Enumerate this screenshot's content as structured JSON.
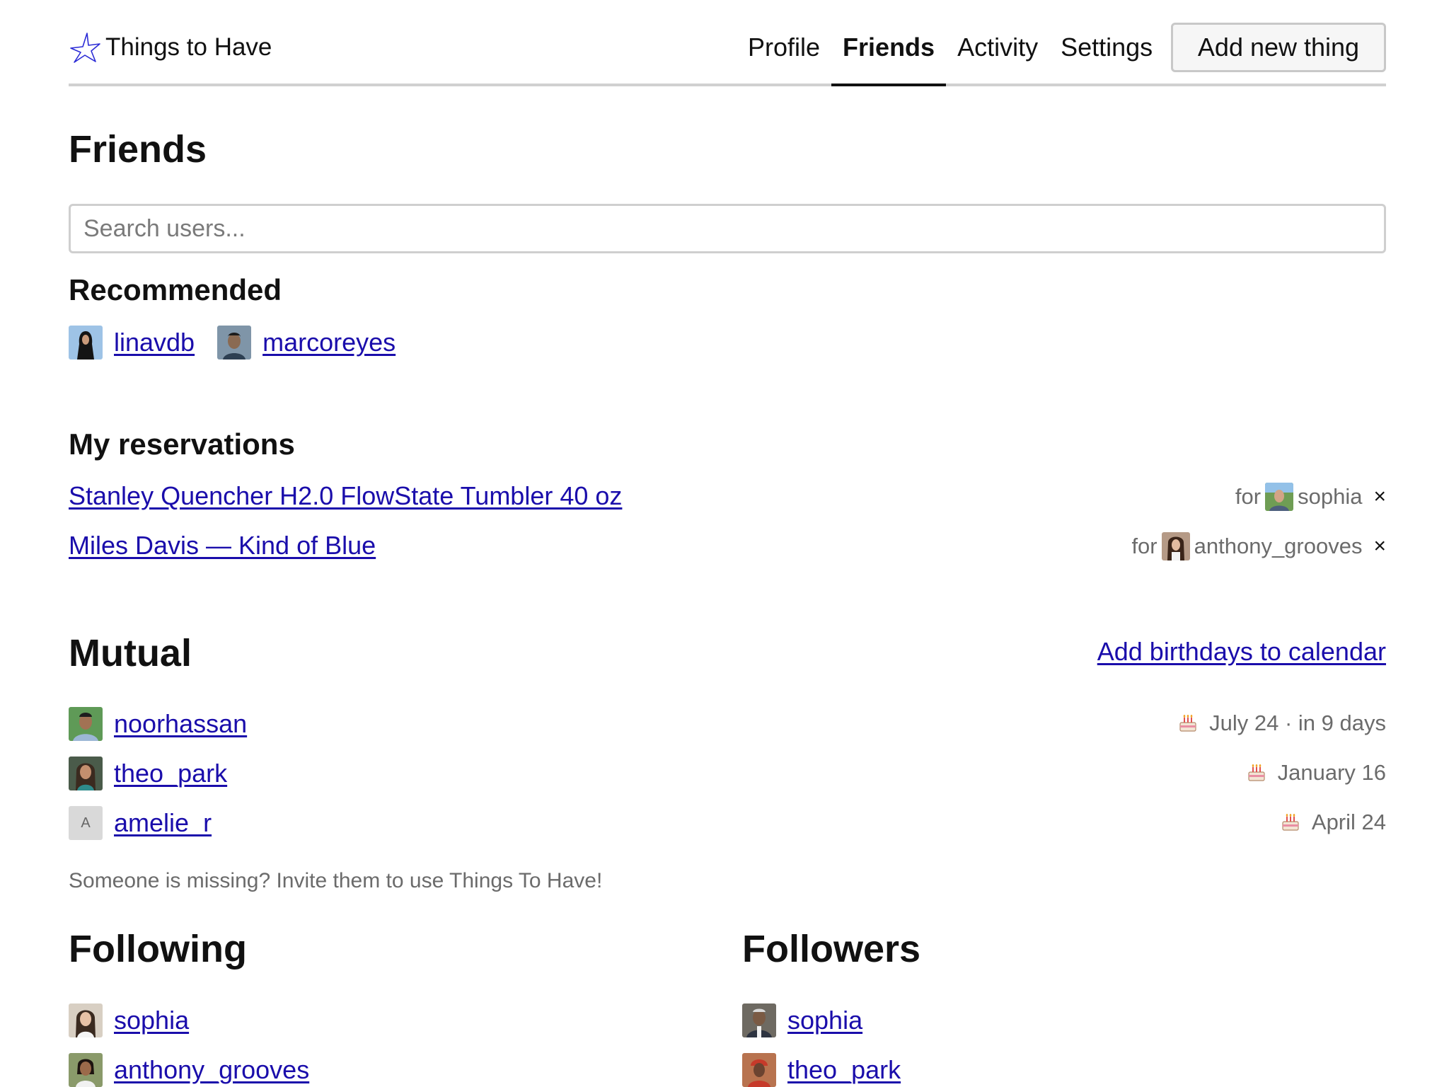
{
  "app": {
    "name": "Things to Have",
    "nav": [
      "Profile",
      "Friends",
      "Activity",
      "Settings"
    ],
    "active_nav": "Friends",
    "add_button": "Add new thing"
  },
  "page": {
    "title": "Friends",
    "search_placeholder": "Search users..."
  },
  "recommended": {
    "heading": "Recommended",
    "users": [
      "linavdb",
      "marcoreyes"
    ]
  },
  "reservations": {
    "heading": "My reservations",
    "items": [
      {
        "title": "Stanley Quencher H2.0 FlowState Tumbler 40 oz",
        "for_label": "for",
        "for_user": "sophia",
        "remove": "×"
      },
      {
        "title": "Miles Davis — Kind of Blue",
        "for_label": "for",
        "for_user": "anthony_grooves",
        "remove": "×"
      }
    ]
  },
  "mutual": {
    "heading": "Mutual",
    "calendar_link": "Add birthdays to calendar",
    "users": [
      {
        "name": "noorhassan",
        "birthday": "July 24 · in 9 days"
      },
      {
        "name": "theo_park",
        "birthday": "January 16"
      },
      {
        "name": "amelie_r",
        "birthday": "April 24",
        "initial": "A"
      }
    ],
    "invite_hint": "Someone is missing? Invite them to use Things To Have!"
  },
  "following": {
    "heading": "Following",
    "users": [
      "sophia",
      "anthony_grooves"
    ]
  },
  "followers": {
    "heading": "Followers",
    "users": [
      "sophia",
      "theo_park"
    ]
  },
  "icons": {
    "brand": "star-outline-icon",
    "birthday": "cake-icon",
    "remove": "close-icon"
  },
  "colors": {
    "link": "#1a0dab",
    "brand_star": "#2b2bd6",
    "muted_text": "#6b6b6b"
  }
}
